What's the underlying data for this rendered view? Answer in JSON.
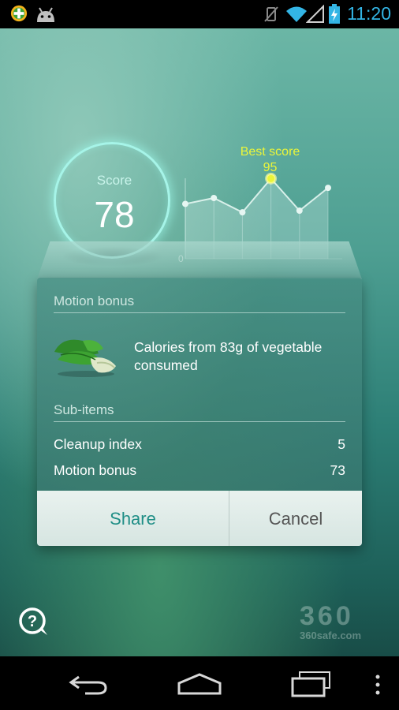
{
  "status_bar": {
    "time": "11:20",
    "left_icons": [
      "plus-badge-icon",
      "android-icon"
    ],
    "right_icons": [
      "vibrate-off-icon",
      "wifi-icon",
      "signal-icon",
      "battery-charging-icon"
    ]
  },
  "score": {
    "label": "Score",
    "value": "78"
  },
  "chart_data": {
    "type": "line",
    "y_min_label": "0",
    "best_label": "Best score",
    "best_value": "95",
    "values": [
      65,
      72,
      55,
      95,
      57,
      84
    ],
    "ylim": [
      0,
      100
    ],
    "area_fill": true
  },
  "dialog": {
    "section_motion": "Motion bonus",
    "item_text": "Calories from 83g of vegetable consumed",
    "item_icon": "bok-choy-icon",
    "section_sub": "Sub-items",
    "rows": [
      {
        "label": "Cleanup index",
        "value": "5"
      },
      {
        "label": "Motion bonus",
        "value": "73"
      }
    ],
    "share_label": "Share",
    "cancel_label": "Cancel"
  },
  "watermark": {
    "logo": "360",
    "url": "360safe.com"
  },
  "colors": {
    "accent": "#1f8e86",
    "best_score": "#eaf53a",
    "clock": "#33b5e5"
  }
}
